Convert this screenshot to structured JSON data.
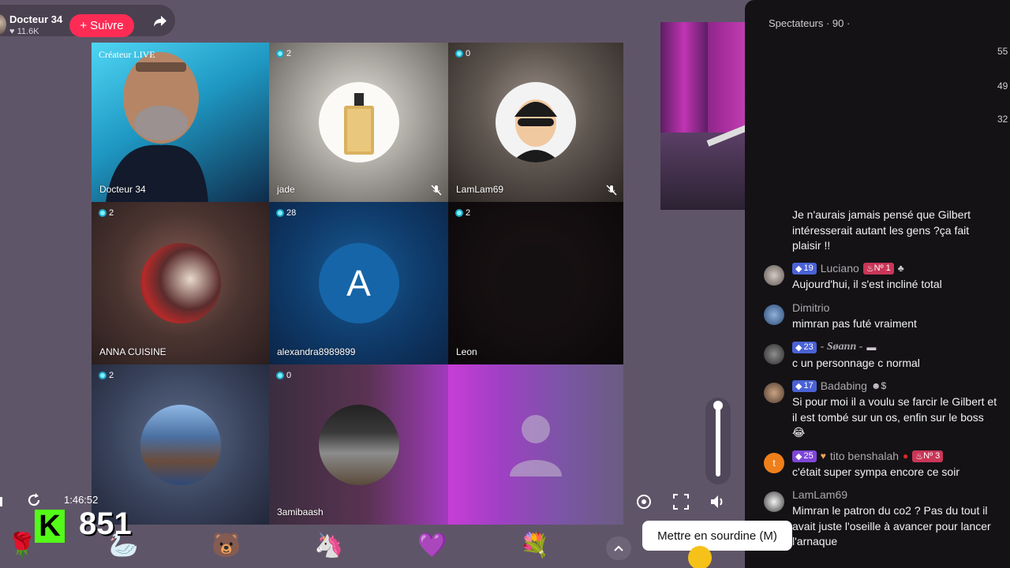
{
  "host": {
    "name": "Docteur 34",
    "likes": "11.6K",
    "follow_label": "Suivre",
    "follow_prefix": "+"
  },
  "tiles": [
    {
      "tag": "Créateur LIVE",
      "name": "Docteur 34",
      "badge": ""
    },
    {
      "badge": "2",
      "name": "jade"
    },
    {
      "badge": "0",
      "name": "LamLam69"
    },
    {
      "badge": "2",
      "name": "ANNA CUISINE"
    },
    {
      "badge": "28",
      "name": "alexandra8989899",
      "initial": "A"
    },
    {
      "badge": "2",
      "name": "Leon"
    },
    {
      "badge": "2",
      "name": ""
    },
    {
      "badge": "0",
      "name": "3amibaash"
    },
    {
      "badge": "",
      "name": ""
    }
  ],
  "chat": {
    "header": "Spectateurs · 90 ·",
    "side_counts": [
      "55",
      "49",
      "32"
    ],
    "messages": [
      {
        "user": "",
        "text": "Je n'aurais jamais pensé que Gilbert intéresserait autant les gens ?ça fait plaisir !!"
      },
      {
        "level": "19",
        "user": "Luciano",
        "rank": "Nº 1",
        "text": "Aujourd'hui, il s'est incliné total"
      },
      {
        "user": "Dimitrio",
        "text": "mimran pas futé vraiment"
      },
      {
        "level": "23",
        "user": "- Søann -",
        "text": "c un personnage c normal"
      },
      {
        "level": "17",
        "user": "Badabing",
        "text": "Si pour moi il a voulu se farcir le Gilbert et il est tombé sur un os, enfin sur le boss 😂"
      },
      {
        "level": "25",
        "user": "tito benshalah",
        "rank": "Nº 3",
        "avatar_letter": "t",
        "text": "c'était super sympa encore ce soir"
      },
      {
        "user": "LamLam69",
        "text": "Mimran le patron du co2 ? Pas du tout il avait juste l'oseille à avancer pour lancer l'arnaque"
      }
    ]
  },
  "controls": {
    "timer": "1:46:52",
    "counter": "851",
    "counter_logo": "K",
    "tooltip": "Mettre en sourdine (M)",
    "volume_level": 1.0
  },
  "gifts": [
    "rose",
    "swan",
    "bear",
    "unicorn",
    "heart-hands",
    "bouquet"
  ],
  "colors": {
    "follow": "#fe2c55",
    "kick_green": "#53fc18",
    "level_blue": "#4a62d6",
    "rank_red": "#c93658"
  }
}
